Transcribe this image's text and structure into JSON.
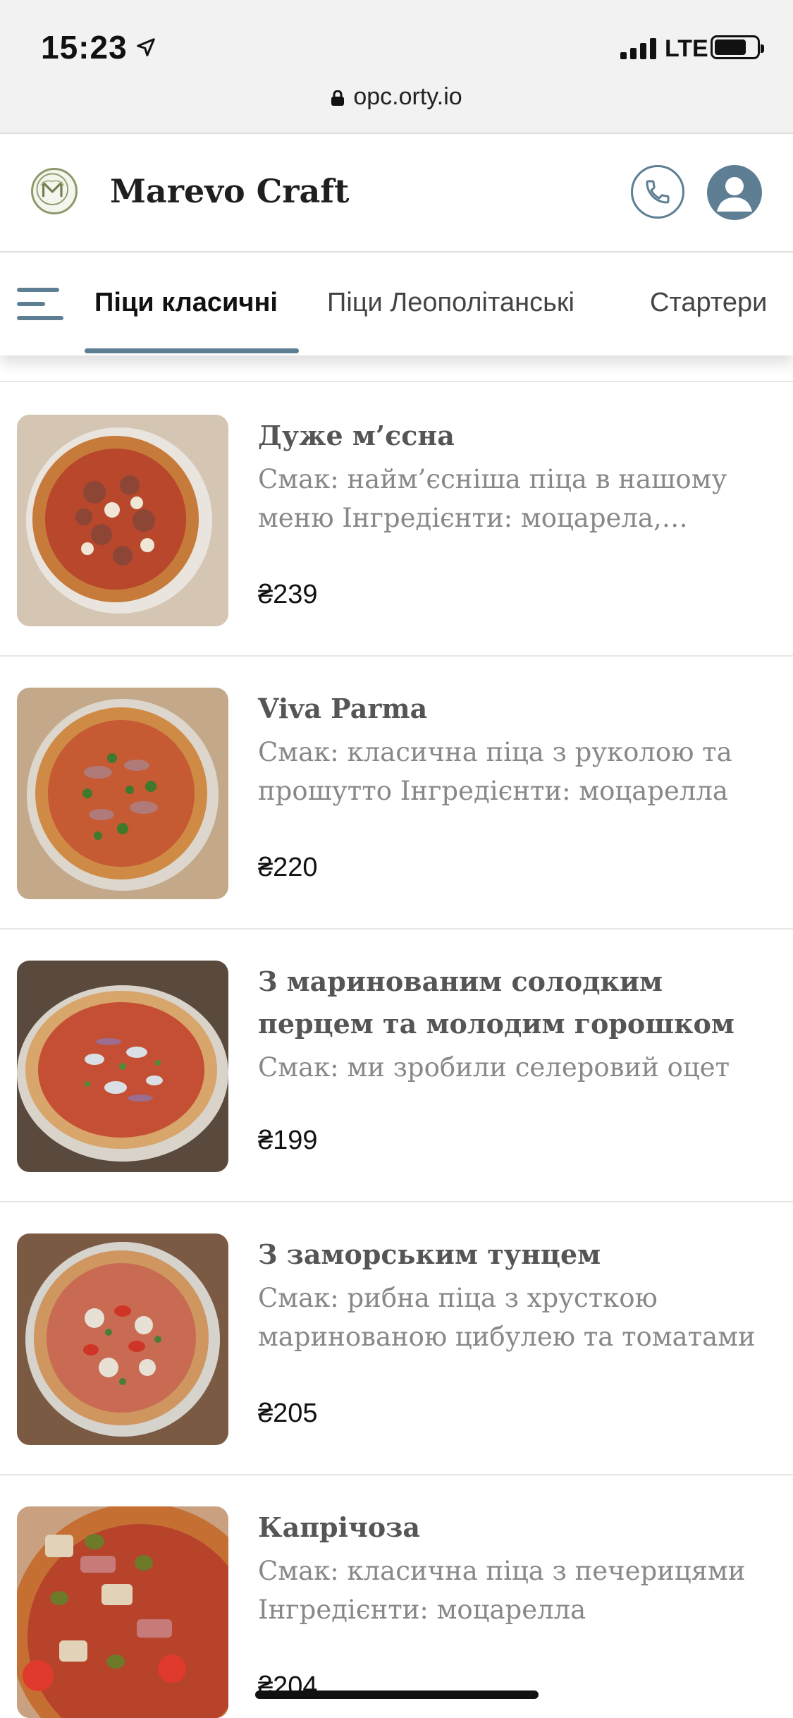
{
  "status_bar": {
    "time": "15:23",
    "network": "LTE"
  },
  "browser": {
    "url": "opc.orty.io"
  },
  "header": {
    "brand": "Marevo Craft"
  },
  "tabs": [
    {
      "label": "Піци класичні",
      "active": true
    },
    {
      "label": "Піци Леополітанські",
      "active": false
    },
    {
      "label": "Стартери",
      "active": false
    }
  ],
  "items": [
    {
      "name": "Дуже м’єсна",
      "description": "Смак: найм’єсніша піца в нашому меню Інгредієнти: моцарела, томатний соус",
      "price": "₴239"
    },
    {
      "name": "Viva Parma",
      "description": "Смак: класична піца з руколою та прошутто Інгредієнти: моцарелла",
      "price": "₴220"
    },
    {
      "name": "З маринованим солодким перцем та молодим горошком",
      "description": "Смак: ми зробили селеровий оцет",
      "price": "₴199"
    },
    {
      "name": "З заморським тунцем",
      "description": "Смак: рибна піца з хрусткою маринованою цибулею та томатами",
      "price": "₴205"
    },
    {
      "name": "Капрічоза",
      "description": "Смак: класична піца з печерицями Інгредієнти: моцарелла",
      "price": "₴204"
    }
  ],
  "colors": {
    "accent": "#5e7e93",
    "status_bar_bg": "#f3f2f2",
    "title_text": "#555555",
    "desc_text": "#888888"
  }
}
